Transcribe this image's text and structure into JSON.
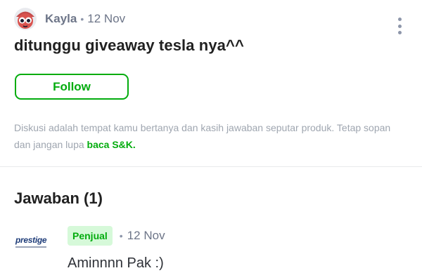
{
  "post": {
    "author": "Kayla",
    "separator": "•",
    "date": "12 Nov",
    "question": "ditunggu giveaway tesla nya^^",
    "follow_label": "Follow",
    "disclaimer_text": "Diskusi adalah tempat kamu bertanya dan kasih jawaban seputar produk. Tetap sopan dan jangan lupa",
    "disclaimer_link": "baca S&K."
  },
  "answers": {
    "title": "Jawaban (1)",
    "items": [
      {
        "seller_logo_text": "prestige",
        "badge": "Penjual",
        "separator": "•",
        "date": "12 Nov",
        "text": "Aminnnn Pak :)"
      }
    ]
  },
  "icons": {
    "avatar": "user-avatar-icon",
    "more": "more-vertical-icon"
  },
  "colors": {
    "accent": "#03ac0e",
    "badge_bg": "#d6f9d9",
    "muted_text": "#6d7588"
  }
}
